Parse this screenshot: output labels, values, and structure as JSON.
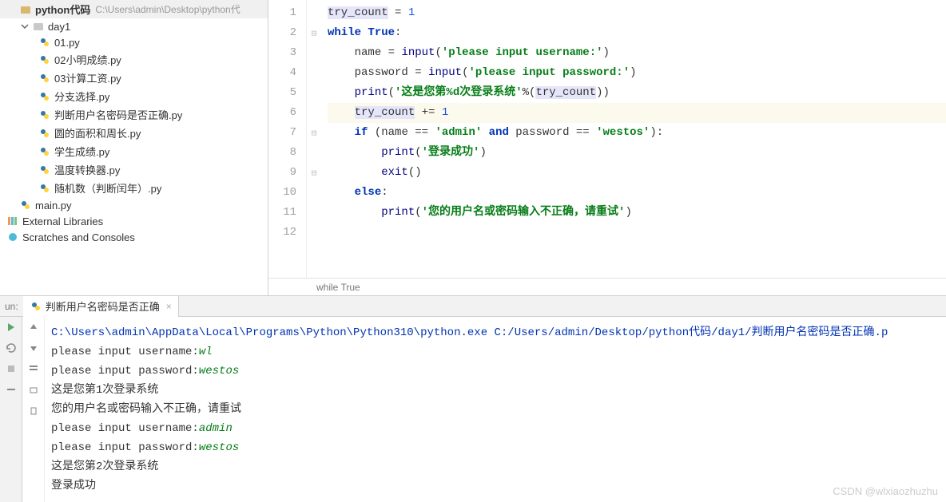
{
  "project": {
    "root_label": "python代码",
    "root_path": "C:\\Users\\admin\\Desktop\\python代",
    "folder": "day1",
    "files": [
      "01.py",
      "02小明成绩.py",
      "03计算工资.py",
      "分支选择.py",
      "判断用户名密码是否正确.py",
      "圆的面积和周长.py",
      "学生成绩.py",
      "温度转换器.py",
      "随机数（判断闰年）.py"
    ],
    "main_file": "main.py",
    "external_libs": "External Libraries",
    "scratches": "Scratches and Consoles"
  },
  "editor": {
    "breadcrumb": "while True",
    "lines": [
      "1",
      "2",
      "3",
      "4",
      "5",
      "6",
      "7",
      "8",
      "9",
      "10",
      "11",
      "12"
    ]
  },
  "code": {
    "l1": {
      "var": "try_count",
      "eq": " = ",
      "num": "1"
    },
    "l2": {
      "kw1": "while ",
      "kw2": "True",
      "colon": ":"
    },
    "l3": {
      "indent": "    ",
      "var": "name",
      "eq": " = ",
      "fn": "input",
      "open": "(",
      "str": "'please input username:'",
      "close": ")"
    },
    "l4": {
      "indent": "    ",
      "var": "password",
      "eq": " = ",
      "fn": "input",
      "open": "(",
      "str": "'please input password:'",
      "close": ")"
    },
    "l5": {
      "indent": "    ",
      "fn": "print",
      "open": "(",
      "str": "'这是您第%d次登录系统'",
      "mod": "%",
      "open2": "(",
      "var": "try_count",
      "close": "))"
    },
    "l6": {
      "indent": "    ",
      "var": "try_count",
      "op": " += ",
      "num": "1"
    },
    "l7": {
      "indent": "    ",
      "kw": "if ",
      "open": "(",
      "v1": "name",
      "eq1": " == ",
      "s1": "'admin'",
      "and": " and ",
      "v2": "password",
      "eq2": " == ",
      "s2": "'westos'",
      "close": "):"
    },
    "l8": {
      "indent": "        ",
      "fn": "print",
      "open": "(",
      "str": "'登录成功'",
      "close": ")"
    },
    "l9": {
      "indent": "        ",
      "fn": "exit",
      "parens": "()"
    },
    "l10": {
      "indent": "    ",
      "kw": "else",
      "colon": ":"
    },
    "l11": {
      "indent": "        ",
      "fn": "print",
      "open": "(",
      "str": "'您的用户名或密码输入不正确，请重试'",
      "close": ")"
    }
  },
  "run": {
    "label": "un:",
    "tab_label": "判断用户名密码是否正确",
    "close": "×",
    "console": {
      "cmd_prefix": "C:\\Users\\admin\\AppData\\Local\\Programs\\Python\\Python310\\python.exe ",
      "cmd_path": "C:/Users/admin/Desktop/python代码/day1/判断用户名密码是否正确.p",
      "l2a": "please input username:",
      "l2b": "wl",
      "l3a": "please input password:",
      "l3b": "westos",
      "l4": "这是您第1次登录系统",
      "l5": "您的用户名或密码输入不正确，请重试",
      "l6a": "please input username:",
      "l6b": "admin",
      "l7a": "please input password:",
      "l7b": "westos",
      "l8": "这是您第2次登录系统",
      "l9": "登录成功"
    }
  },
  "watermark": "CSDN @wlxiaozhuzhu"
}
